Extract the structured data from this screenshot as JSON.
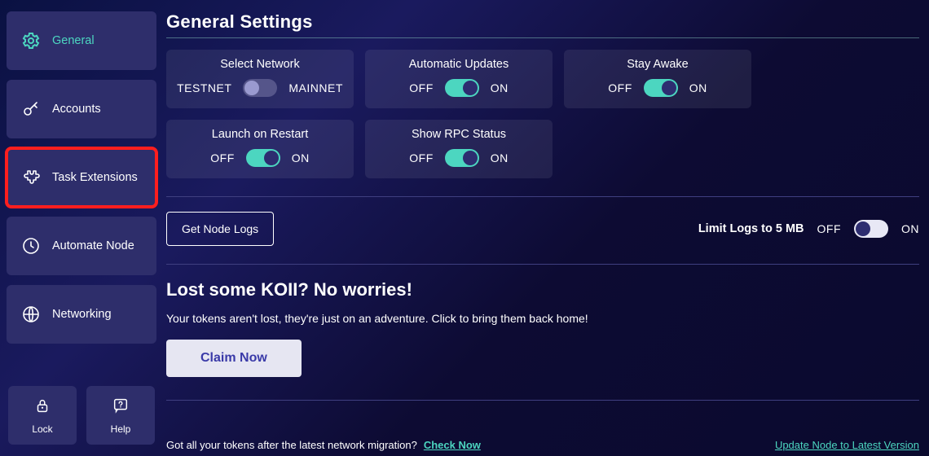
{
  "sidebar": {
    "items": [
      {
        "label": "General",
        "icon": "gear",
        "active": true,
        "highlight": false
      },
      {
        "label": "Accounts",
        "icon": "key",
        "active": false,
        "highlight": false
      },
      {
        "label": "Task Extensions",
        "icon": "puzzle",
        "active": false,
        "highlight": true
      },
      {
        "label": "Automate Node",
        "icon": "clock",
        "active": false,
        "highlight": false
      },
      {
        "label": "Networking",
        "icon": "globe",
        "active": false,
        "highlight": false
      }
    ],
    "footer": [
      {
        "label": "Lock",
        "icon": "lock"
      },
      {
        "label": "Help",
        "icon": "help"
      }
    ]
  },
  "page": {
    "title": "General Settings",
    "cards": [
      {
        "title": "Select Network",
        "left": "TESTNET",
        "right": "MAINNET",
        "on": false
      },
      {
        "title": "Automatic Updates",
        "left": "OFF",
        "right": "ON",
        "on": true
      },
      {
        "title": "Stay Awake",
        "left": "OFF",
        "right": "ON",
        "on": true
      },
      {
        "title": "Launch on Restart",
        "left": "OFF",
        "right": "ON",
        "on": false
      },
      {
        "title": "Show RPC Status",
        "left": "OFF",
        "right": "ON",
        "on": true
      }
    ],
    "logs_button": "Get Node Logs",
    "limit_logs": {
      "label": "Limit Logs to 5 MB",
      "left": "OFF",
      "right": "ON",
      "on": false
    },
    "lost": {
      "heading": "Lost some KOII? No worries!",
      "sub": "Your tokens aren't lost, they're just on an adventure. Click to bring them back home!",
      "cta": "Claim Now"
    },
    "footer": {
      "question": "Got all your tokens after the latest network migration?",
      "check": "Check Now",
      "update": "Update Node to Latest Version"
    }
  }
}
